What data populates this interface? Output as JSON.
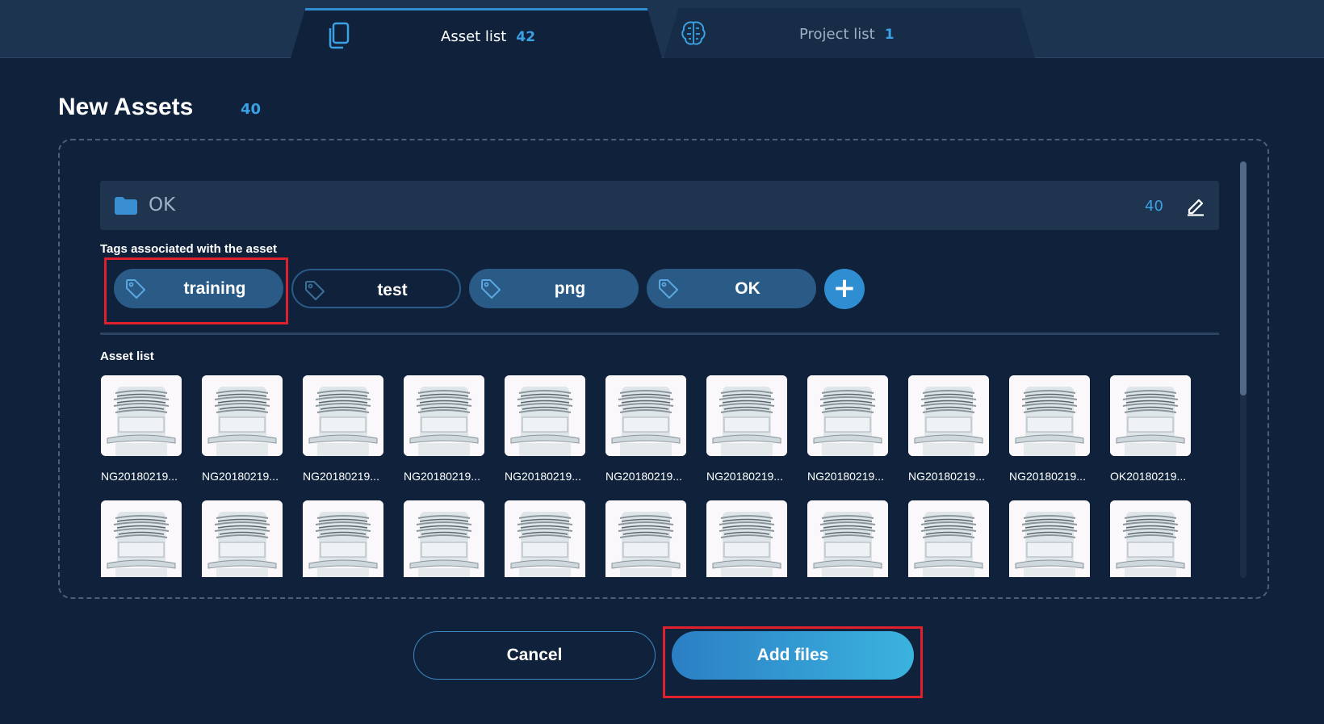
{
  "tabs": [
    {
      "label": "Asset list",
      "count": "42",
      "active": true,
      "icon": "copy-icon"
    },
    {
      "label": "Project list",
      "count": "1",
      "active": false,
      "icon": "brain-icon"
    }
  ],
  "page": {
    "title": "New Assets",
    "count": "40"
  },
  "folder": {
    "name": "OK",
    "count": "40",
    "icon": "folder-icon",
    "edit_icon": "pencil-icon"
  },
  "tags_section": {
    "label": "Tags associated with the asset"
  },
  "tags": [
    {
      "label": "training",
      "style": "filled",
      "highlighted": true
    },
    {
      "label": "test",
      "style": "outline",
      "highlighted": false
    },
    {
      "label": "png",
      "style": "filled",
      "highlighted": false
    },
    {
      "label": "OK",
      "style": "filled",
      "highlighted": false
    }
  ],
  "add_tag_label": "+",
  "asset_section": {
    "label": "Asset list"
  },
  "assets_row1": [
    "NG20180219...",
    "NG20180219...",
    "NG20180219...",
    "NG20180219...",
    "NG20180219...",
    "NG20180219...",
    "NG20180219...",
    "NG20180219...",
    "NG20180219...",
    "NG20180219...",
    "OK20180219..."
  ],
  "assets_row2_count": 11,
  "buttons": {
    "cancel": "Cancel",
    "add": "Add files",
    "add_highlighted": true
  },
  "colors": {
    "background": "#10223b",
    "accent": "#3aa1e4",
    "tag_fill": "#2a5b86",
    "highlight": "#e0202c"
  }
}
